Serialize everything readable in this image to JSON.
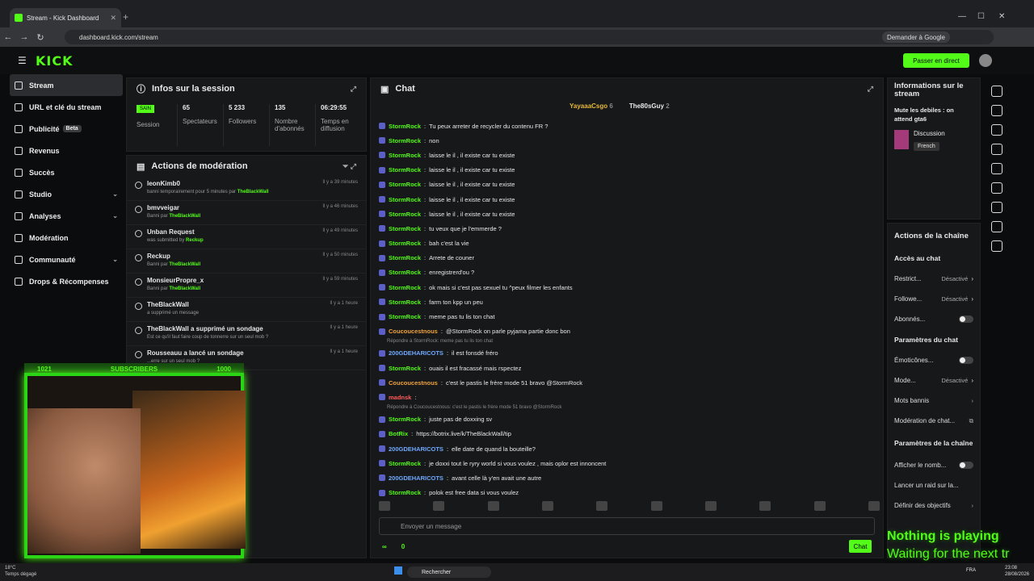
{
  "browser": {
    "tab_title": "Stream - Kick Dashboard",
    "url": "dashboard.kick.com/stream",
    "google_btn": "Demander à Google"
  },
  "topnav": {
    "logo": "KICK",
    "live_btn": "Passer en direct"
  },
  "sidebar": {
    "items": [
      {
        "label": "Stream"
      },
      {
        "label": "URL et clé du stream"
      },
      {
        "label": "Publicité",
        "badge": "Beta"
      },
      {
        "label": "Revenus"
      },
      {
        "label": "Succès"
      },
      {
        "label": "Studio"
      },
      {
        "label": "Analyses"
      },
      {
        "label": "Modération"
      },
      {
        "label": "Communauté"
      },
      {
        "label": "Drops & Récompenses"
      }
    ]
  },
  "session": {
    "title": "Infos sur la session",
    "status": "SAIN",
    "status_label": "Session",
    "stats": [
      {
        "value": "65",
        "label": "Spectateurs"
      },
      {
        "value": "5 233",
        "label": "Followers"
      },
      {
        "value": "135",
        "label": "Nombre d'abonnés"
      },
      {
        "value": "06:29:55",
        "label": "Temps en diffusion"
      }
    ]
  },
  "moderation": {
    "title": "Actions de modération",
    "rows": [
      {
        "user": "leonKimb0",
        "action": "banni temporairement pour 5 minutes par",
        "by": "TheBlackWall",
        "time": "Il y a 39 minutes"
      },
      {
        "user": "bmvveigar",
        "action": "Banni par",
        "by": "TheBlackWall",
        "time": "Il y a 46 minutes"
      },
      {
        "user": "Unban Request",
        "action": "was submitted by",
        "by": "Reckup",
        "time": "Il y a 49 minutes"
      },
      {
        "user": "Reckup",
        "action": "Banni par",
        "by": "TheBlackWall",
        "time": "Il y a 50 minutes"
      },
      {
        "user": "MonsieurPropre_x",
        "action": "Banni par",
        "by": "TheBlackWall",
        "time": "Il y a 59 minutes"
      },
      {
        "user": "TheBlackWall",
        "action": "a supprimé un message",
        "by": "",
        "time": "Il y a 1 heure"
      },
      {
        "user": "TheBlackWall a supprimé un sondage",
        "action": "Est ce qu'il faut faire coup de tonnerre sur un seul mob ?",
        "by": "",
        "time": "Il y a 1 heure"
      },
      {
        "user": "Rousseauu a lancé un sondage",
        "action": "...erre sur un seul mob ?",
        "by": "",
        "time": "Il y a 1 heure"
      }
    ]
  },
  "webcam": {
    "left": "1021",
    "mid": "SUBSCRIBERS",
    "right": "1000"
  },
  "chat": {
    "title": "Chat",
    "top_users": [
      {
        "name": "YayaaaCsgo",
        "count": "6"
      },
      {
        "name": "The80sGuy",
        "count": "2"
      }
    ],
    "messages": [
      {
        "user": "StormRock",
        "text": "Tu peux arreter de recycler du contenu FR ?",
        "color": "green"
      },
      {
        "user": "StormRock",
        "text": "non",
        "color": "green"
      },
      {
        "user": "StormRock",
        "text": "laisse le il , il existe car tu existe",
        "color": "green"
      },
      {
        "user": "StormRock",
        "text": "laisse le il , il existe car tu existe",
        "color": "green"
      },
      {
        "user": "StormRock",
        "text": "laisse le il , il existe car tu existe",
        "color": "green"
      },
      {
        "user": "StormRock",
        "text": "laisse le il , il existe car tu existe",
        "color": "green"
      },
      {
        "user": "StormRock",
        "text": "laisse le il , il existe car tu existe",
        "color": "green"
      },
      {
        "user": "StormRock",
        "text": "tu veux que je l'emmerde ?",
        "color": "green"
      },
      {
        "user": "StormRock",
        "text": "bah c'est la vie",
        "color": "green"
      },
      {
        "user": "StormRock",
        "text": "Arrete de couner",
        "color": "green"
      },
      {
        "user": "StormRock",
        "text": "enregistrerd'ou ?",
        "color": "green"
      },
      {
        "user": "StormRock",
        "text": "ok mais si c'est pas sexuel tu ^peux filmer les enfants",
        "color": "green"
      },
      {
        "user": "StormRock",
        "text": "farm ton kpp un peu",
        "color": "green"
      },
      {
        "user": "StormRock",
        "text": "meme pas tu lis ton chat",
        "color": "green"
      },
      {
        "user": "Coucoucestnous",
        "text": "@StormRock on parle pyjama partie donc bon",
        "color": "orange"
      },
      {
        "reply": "Répondre à StormRock: meme pas tu lis ton chat",
        "user": "200GDEHARICOTS",
        "text": "il est fonsdé fréro",
        "color": "blue"
      },
      {
        "user": "StormRock",
        "text": "ouais il est fracassé mais rspectez",
        "color": "green"
      },
      {
        "user": "Coucoucestnous",
        "text": "c'est le pastis le frère mode 51 bravo @StormRock",
        "color": "orange"
      },
      {
        "user": "madnsk",
        "text": "",
        "color": "red"
      },
      {
        "reply": "Répondre à Coucoucestnous: c'est le pastis le frère mode 51 bravo @StormRock",
        "user": "StormRock",
        "text": "juste pas de doxxing sv",
        "color": "green"
      },
      {
        "user": "BotRix",
        "text": "https://botrix.live/k/TheBlackWall/tip",
        "color": "green"
      },
      {
        "user": "200GDEHARICOTS",
        "text": "elle date de quand la bouteille?",
        "color": "blue"
      },
      {
        "user": "StormRock",
        "text": "je doxxi tout le ryry world si vous voulez , mais oplor est innoncent",
        "color": "green"
      },
      {
        "user": "200GDEHARICOTS",
        "text": "avant celle là y'en avait une autre",
        "color": "blue"
      },
      {
        "user": "StormRock",
        "text": "polok est free data si vous voulez",
        "color": "green"
      }
    ],
    "input_placeholder": "Envoyer un message",
    "footer_left": "∞",
    "footer_right": "0",
    "send_btn": "Chat"
  },
  "stream_info": {
    "title": "Informations sur le stream",
    "stream_title": "Mute les debiles : on attend gta6",
    "category": "Discussion",
    "language": "French"
  },
  "channel_actions": {
    "title": "Actions de la chaîne",
    "chat_access": "Accès au chat",
    "rows1": [
      {
        "label": "Restrict...",
        "value": "Désactivé"
      },
      {
        "label": "Followe...",
        "value": "Désactivé"
      },
      {
        "label": "Abonnés..."
      }
    ],
    "chat_params": "Paramètres du chat",
    "rows2": [
      {
        "label": "Émoticônes..."
      },
      {
        "label": "Mode...",
        "value": "Désactivé"
      },
      {
        "label": "Mots bannis"
      },
      {
        "label": "Modération de chat..."
      }
    ],
    "channel_params": "Paramètres de la chaîne",
    "rows3": [
      {
        "label": "Afficher le nomb..."
      },
      {
        "label": "Lancer un raid sur la..."
      },
      {
        "label": "Définir des objectifs"
      }
    ]
  },
  "overlay": {
    "now_playing": "Nothing is playing",
    "waiting": "Waiting for the next tr"
  },
  "taskbar": {
    "search": "Rechercher",
    "weather_temp": "18°C",
    "weather_desc": "Temps dégagé",
    "lang": "FRA",
    "time": "23:08",
    "date": "28/08/2026"
  }
}
